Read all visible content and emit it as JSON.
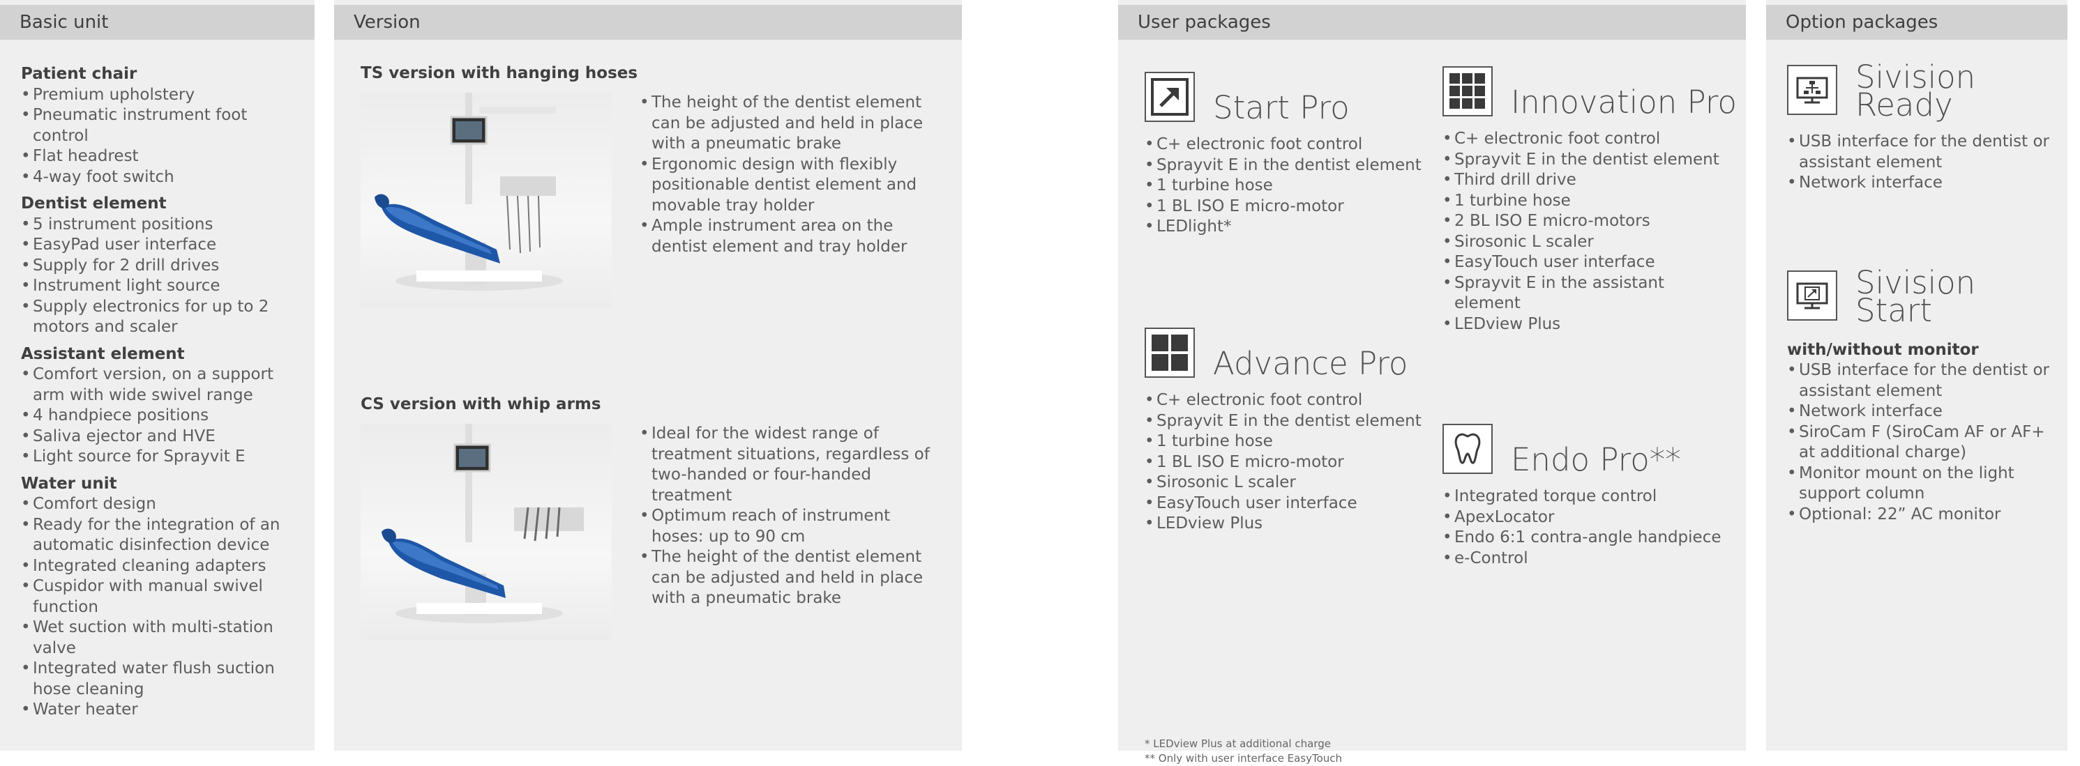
{
  "basic_unit": {
    "header": "Basic unit",
    "groups": [
      {
        "title": "Patient chair",
        "items": [
          "Premium upholstery",
          "Pneumatic instrument foot control",
          "Flat headrest",
          "4-way foot switch"
        ]
      },
      {
        "title": "Dentist element",
        "items": [
          "5 instrument positions",
          "EasyPad user interface",
          "Supply for 2 drill drives",
          "Instrument light source",
          "Supply electronics for up to 2 motors and scaler"
        ]
      },
      {
        "title": "Assistant element",
        "items": [
          "Comfort version, on a support arm with wide swivel range",
          "4 handpiece positions",
          "Saliva ejector and HVE",
          "Light source for Sprayvit E"
        ]
      },
      {
        "title": "Water unit",
        "items": [
          "Comfort design",
          "Ready for the integration of an automatic disinfection device",
          "Integrated cleaning adapters",
          "Cuspidor with manual swivel function",
          "Wet suction with multi-station valve",
          "Integrated water flush suction hose cleaning",
          "Water heater"
        ]
      }
    ]
  },
  "version": {
    "header": "Version",
    "sections": [
      {
        "title": "TS version with hanging hoses",
        "items": [
          "The height of the dentist element can be adjusted and held in place with a pneumatic brake",
          "Ergonomic design with flexibly positionable dentist element and movable tray holder",
          "Ample instrument area on the dentist element and tray holder"
        ]
      },
      {
        "title": "CS version with whip arms",
        "items": [
          "Ideal for the widest range of treatment situations, regardless of two-handed or four-handed treatment",
          "Optimum reach of instrument hoses: up to 90 cm",
          "The height of the dentist element can be adjusted and held in place with a pneumatic brake"
        ]
      }
    ]
  },
  "user_packages": {
    "header": "User packages",
    "packages": [
      {
        "name": "Start Pro",
        "icon": "arrow-icon",
        "items": [
          "C+ electronic foot control",
          "Sprayvit E in the dentist element",
          "1 turbine hose",
          "1 BL ISO E micro-motor",
          "LEDlight*"
        ]
      },
      {
        "name": "Innovation Pro",
        "icon": "nine-grid-icon",
        "items": [
          "C+ electronic foot control",
          "Sprayvit E in the dentist element",
          "Third drill drive",
          "1 turbine hose",
          "2 BL ISO E micro-motors",
          "Sirosonic L scaler",
          "EasyTouch user interface",
          "Sprayvit E in the assistant element",
          "LEDview Plus"
        ]
      },
      {
        "name": "Advance Pro",
        "icon": "four-grid-icon",
        "items": [
          "C+ electronic foot control",
          "Sprayvit E in the dentist element",
          "1 turbine hose",
          "1 BL ISO E micro-motor",
          "Sirosonic L scaler",
          "EasyTouch user interface",
          "LEDview Plus"
        ]
      },
      {
        "name": "Endo Pro**",
        "icon": "tooth-icon",
        "items": [
          "Integrated torque control",
          "ApexLocator",
          "Endo 6:1 contra-angle handpiece",
          "e-Control"
        ]
      }
    ],
    "footnotes": [
      "*   LEDview Plus at additional charge",
      "** Only with user interface EasyTouch"
    ]
  },
  "option_packages": {
    "header": "Option packages",
    "packages": [
      {
        "name_line1": "Sivision",
        "name_line2": "Ready",
        "icon": "monitor-network-icon",
        "subtitle": "",
        "items": [
          "USB interface for the dentist or assistant element",
          "Network interface"
        ]
      },
      {
        "name_line1": "Sivision",
        "name_line2": "Start",
        "icon": "monitor-arrow-icon",
        "subtitle": "with/without monitor",
        "items": [
          "USB interface for the dentist or assistant element",
          "Network interface",
          "SiroCam F (SiroCam AF or AF+ at additional charge)",
          "Monitor mount on the light support column",
          "Optional: 22” AC monitor"
        ]
      }
    ]
  }
}
